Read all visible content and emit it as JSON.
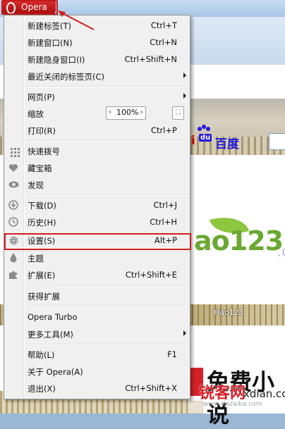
{
  "app": {
    "menu_button_label": "Opera"
  },
  "background": {
    "baidu_text": "百度",
    "baidu_paw_label": "du",
    "baidu_partial_letter": "i",
    "hao_logo": "ao123",
    "hao_dot": ".c",
    "hao_thumb_label": "Hao123",
    "mfxs_text": "免费小说",
    "watermark_main": "锐客网",
    "watermark_domain": "xdian.cc",
    "watermark_sub": "www.xiazaiba.com"
  },
  "menu": {
    "items": [
      {
        "label": "新建标签(T)",
        "shortcut": "Ctrl+T",
        "icon": ""
      },
      {
        "label": "新建窗口(N)",
        "shortcut": "Ctrl+N",
        "icon": ""
      },
      {
        "label": "新建隐身窗口(I)",
        "shortcut": "Ctrl+Shift+N",
        "icon": ""
      },
      {
        "label": "最近关闭的标签页(C)",
        "shortcut": "",
        "submenu": true,
        "icon": ""
      },
      {
        "label": "网页(P)",
        "shortcut": "",
        "submenu": true,
        "icon": ""
      },
      {
        "label": "缩放",
        "zoom_value": "100%",
        "icon": ""
      },
      {
        "label": "打印(R)",
        "shortcut": "Ctrl+P",
        "icon": ""
      },
      {
        "label": "快速拨号",
        "shortcut": "",
        "icon": "speed-dial-icon"
      },
      {
        "label": "藏宝箱",
        "shortcut": "",
        "icon": "heart-icon"
      },
      {
        "label": "发现",
        "shortcut": "",
        "icon": "eye-icon"
      },
      {
        "label": "下载(D)",
        "shortcut": "Ctrl+J",
        "icon": "download-icon"
      },
      {
        "label": "历史(H)",
        "shortcut": "Ctrl+H",
        "icon": "history-clock-icon"
      },
      {
        "label": "设置(S)",
        "shortcut": "Alt+P",
        "icon": "gear-icon"
      },
      {
        "label": "主题",
        "shortcut": "",
        "icon": "theme-drop-icon"
      },
      {
        "label": "扩展(E)",
        "shortcut": "Ctrl+Shift+E",
        "icon": "puzzle-icon"
      },
      {
        "label": "获得扩展",
        "shortcut": "",
        "icon": ""
      },
      {
        "label": "Opera Turbo",
        "shortcut": "",
        "icon": ""
      },
      {
        "label": "更多工具(M)",
        "shortcut": "",
        "submenu": true,
        "icon": ""
      },
      {
        "label": "帮助(L)",
        "shortcut": "F1",
        "icon": ""
      },
      {
        "label": "关于 Opera(A)",
        "shortcut": "",
        "icon": ""
      },
      {
        "label": "退出(X)",
        "shortcut": "Ctrl+Shift+X",
        "icon": ""
      }
    ],
    "zoom_prev_symbol": "‹",
    "zoom_next_symbol": "›",
    "zoom_fit_symbol": "⛶"
  },
  "colors": {
    "highlight_red": "#d21f1f",
    "opera_red": "#c41a1a",
    "menu_bg": "#f0f0f0"
  }
}
